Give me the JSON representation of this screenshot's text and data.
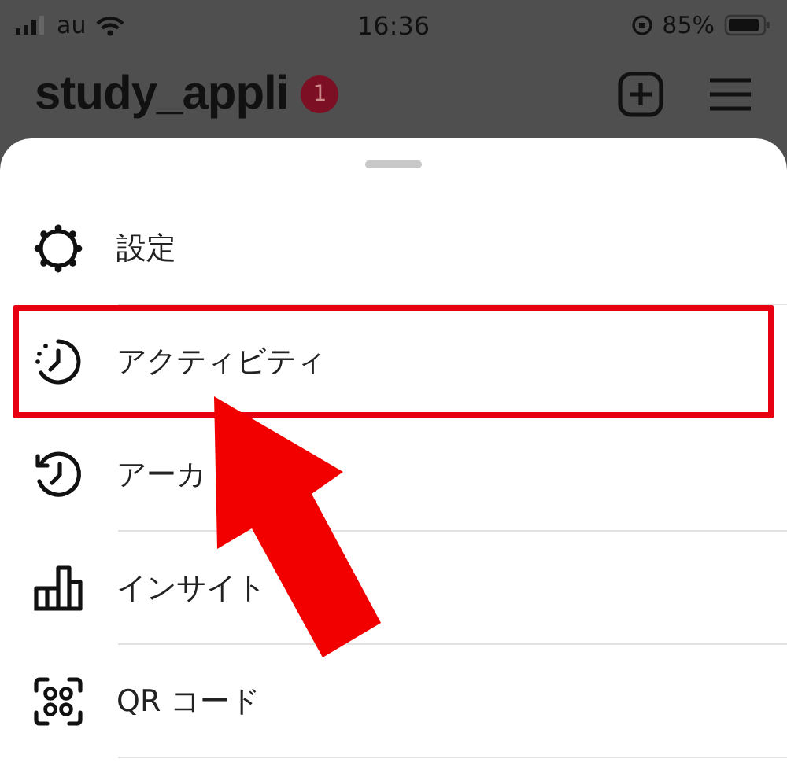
{
  "status_bar": {
    "carrier": "au",
    "time": "16:36",
    "battery_percent": "85%"
  },
  "header": {
    "title": "study_appli",
    "badge": "1"
  },
  "menu": {
    "items": [
      {
        "kind": "settings",
        "label": "設定",
        "highlighted": false
      },
      {
        "kind": "activity",
        "label": "アクティビティ",
        "highlighted": true
      },
      {
        "kind": "archive",
        "label": "アーカ",
        "highlighted": false
      },
      {
        "kind": "insights",
        "label": "インサイト",
        "highlighted": false
      },
      {
        "kind": "qr",
        "label": "QR コード",
        "highlighted": false
      }
    ]
  }
}
